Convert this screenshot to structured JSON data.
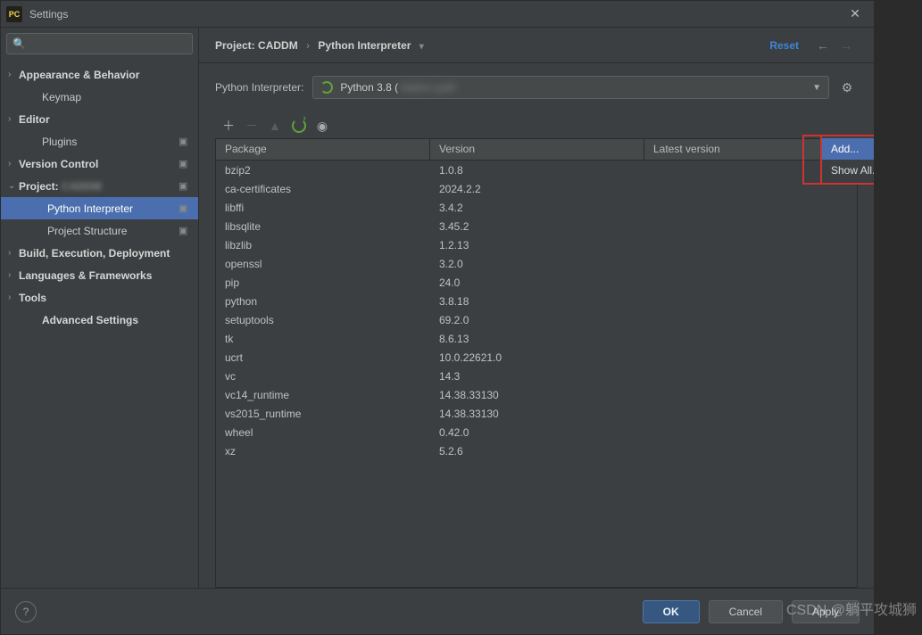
{
  "titlebar": {
    "app_icon": "PC",
    "title": "Settings"
  },
  "search": {
    "placeholder": ""
  },
  "sidebar": [
    {
      "label": "Appearance & Behavior",
      "chev": "›",
      "bold": true,
      "link": false,
      "sub": 0
    },
    {
      "label": "Keymap",
      "chev": "",
      "bold": false,
      "link": false,
      "sub": 1
    },
    {
      "label": "Editor",
      "chev": "›",
      "bold": true,
      "link": false,
      "sub": 0
    },
    {
      "label": "Plugins",
      "chev": "",
      "bold": false,
      "link": true,
      "sub": 1
    },
    {
      "label": "Version Control",
      "chev": "›",
      "bold": true,
      "link": true,
      "sub": 0
    },
    {
      "label": "Project:",
      "chev": "⌄",
      "bold": true,
      "link": true,
      "sub": 0,
      "blurExtra": "CADDM"
    },
    {
      "label": "Python Interpreter",
      "chev": "",
      "bold": false,
      "link": true,
      "sub": 2,
      "sel": true
    },
    {
      "label": "Project Structure",
      "chev": "",
      "bold": false,
      "link": true,
      "sub": 2
    },
    {
      "label": "Build, Execution, Deployment",
      "chev": "›",
      "bold": true,
      "link": false,
      "sub": 0
    },
    {
      "label": "Languages & Frameworks",
      "chev": "›",
      "bold": true,
      "link": false,
      "sub": 0
    },
    {
      "label": "Tools",
      "chev": "›",
      "bold": true,
      "link": false,
      "sub": 0
    },
    {
      "label": "Advanced Settings",
      "chev": "",
      "bold": true,
      "link": false,
      "sub": 1
    }
  ],
  "breadcrumb": {
    "proj_prefix": "Project:",
    "proj_name": "CADDM",
    "page": "Python Interpreter"
  },
  "topActions": {
    "reset": "Reset"
  },
  "interpreter": {
    "label": "Python Interpreter:",
    "name": "Python 3.8 (",
    "path": "hidden-path",
    "close": ")"
  },
  "columns": {
    "pkg": "Package",
    "ver": "Version",
    "lat": "Latest version"
  },
  "packages": [
    {
      "name": "bzip2",
      "ver": "1.0.8"
    },
    {
      "name": "ca-certificates",
      "ver": "2024.2.2"
    },
    {
      "name": "libffi",
      "ver": "3.4.2"
    },
    {
      "name": "libsqlite",
      "ver": "3.45.2"
    },
    {
      "name": "libzlib",
      "ver": "1.2.13"
    },
    {
      "name": "openssl",
      "ver": "3.2.0"
    },
    {
      "name": "pip",
      "ver": "24.0"
    },
    {
      "name": "python",
      "ver": "3.8.18"
    },
    {
      "name": "setuptools",
      "ver": "69.2.0"
    },
    {
      "name": "tk",
      "ver": "8.6.13"
    },
    {
      "name": "ucrt",
      "ver": "10.0.22621.0"
    },
    {
      "name": "vc",
      "ver": "14.3"
    },
    {
      "name": "vc14_runtime",
      "ver": "14.38.33130"
    },
    {
      "name": "vs2015_runtime",
      "ver": "14.38.33130"
    },
    {
      "name": "wheel",
      "ver": "0.42.0"
    },
    {
      "name": "xz",
      "ver": "5.2.6"
    }
  ],
  "dropdown": {
    "add": "Add...",
    "showAll": "Show All..."
  },
  "footer": {
    "ok": "OK",
    "cancel": "Cancel",
    "apply": "Apply"
  },
  "watermark": "CSDN @躺平攻城狮"
}
